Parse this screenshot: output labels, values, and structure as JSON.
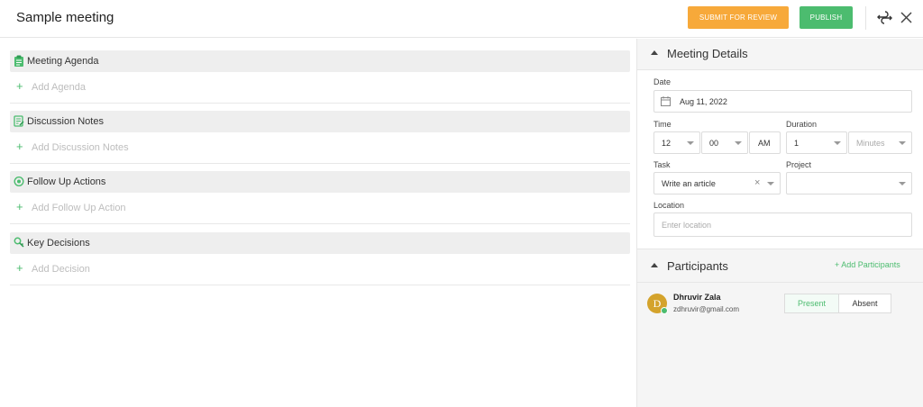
{
  "header": {
    "title": "Sample meeting",
    "submit_label": "SUBMIT FOR REVIEW",
    "publish_label": "PUBLISH",
    "icons": [
      "swap-icon",
      "close-icon"
    ]
  },
  "sections": [
    {
      "title": "Meeting Agenda",
      "add_label": "Add Agenda",
      "icon": "clipboard-icon"
    },
    {
      "title": "Discussion Notes",
      "add_label": "Add Discussion Notes",
      "icon": "notes-icon"
    },
    {
      "title": "Follow Up Actions",
      "add_label": "Add Follow Up Action",
      "icon": "target-icon"
    },
    {
      "title": "Key Decisions",
      "add_label": "Add Decision",
      "icon": "key-icon"
    }
  ],
  "details": {
    "title": "Meeting Details",
    "date_label": "Date",
    "date_value": "Aug 11, 2022",
    "time_label": "Time",
    "hour": "12",
    "minute": "00",
    "ampm": "AM",
    "duration_label": "Duration",
    "duration_value": "1",
    "duration_unit_placeholder": "Minutes",
    "task_label": "Task",
    "task_value": "Write an article",
    "project_label": "Project",
    "project_value": "",
    "location_label": "Location",
    "location_placeholder": "Enter location"
  },
  "participants": {
    "title": "Participants",
    "add_label": "+ Add Participants",
    "people": [
      {
        "initial": "D",
        "name": "Dhruvir Zala",
        "email": "zdhruvir@gmail.com",
        "status": "Present"
      }
    ],
    "present_label": "Present",
    "absent_label": "Absent"
  },
  "colors": {
    "submit": "#f7a93a",
    "publish": "#4cbc6f",
    "accent": "#4cbc6f",
    "avatar": "#d4a32c"
  }
}
